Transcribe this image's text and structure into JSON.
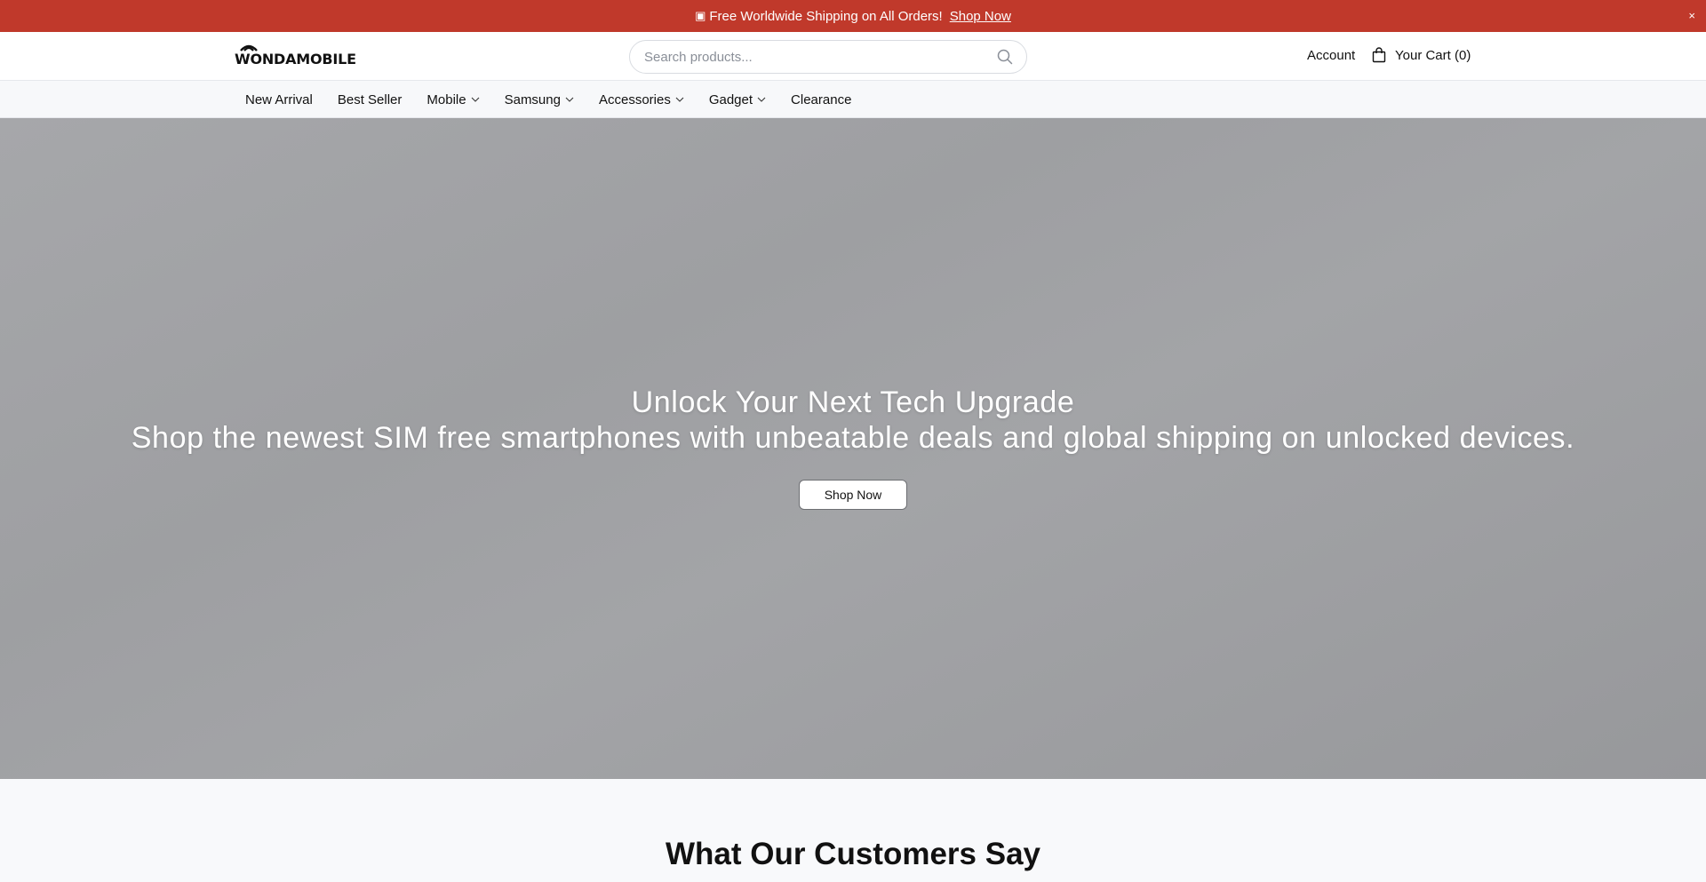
{
  "announcement": {
    "icon": "gift-icon",
    "text": "Free Worldwide Shipping on All Orders!",
    "cta": "Shop Now",
    "close_label": "×",
    "background": "#c0392b"
  },
  "header": {
    "logo_text": "WONDAMOBILE",
    "search_placeholder": "Search products...",
    "account_label": "Account",
    "cart_label": "Your Cart (0)"
  },
  "nav": {
    "items": [
      {
        "label": "New Arrival",
        "has_dropdown": false
      },
      {
        "label": "Best Seller",
        "has_dropdown": false
      },
      {
        "label": "Mobile",
        "has_dropdown": true
      },
      {
        "label": "Samsung",
        "has_dropdown": true
      },
      {
        "label": "Accessories",
        "has_dropdown": true
      },
      {
        "label": "Gadget",
        "has_dropdown": true
      },
      {
        "label": "Clearance",
        "has_dropdown": false
      }
    ]
  },
  "hero": {
    "title": "Unlock Your Next Tech Upgrade",
    "subtitle": "Shop the newest SIM free smartphones with unbeatable deals and global shipping on unlocked devices.",
    "cta": "Shop Now"
  },
  "reviews": {
    "heading": "What Our Customers Say"
  }
}
